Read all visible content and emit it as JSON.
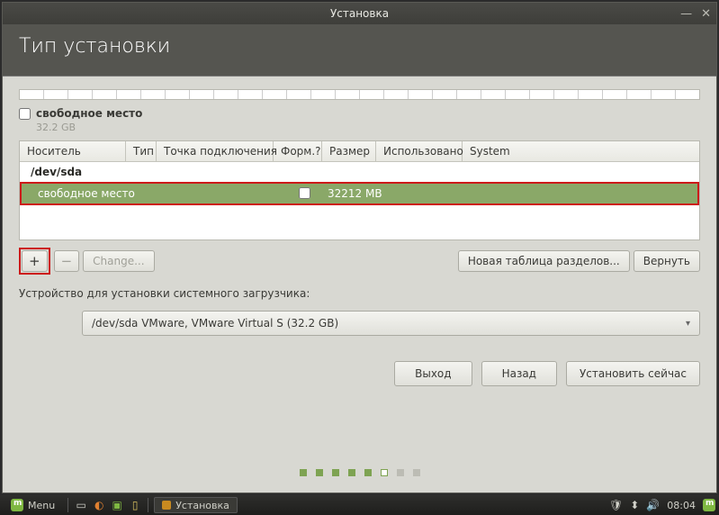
{
  "window": {
    "title": "Установка",
    "header": "Тип установки"
  },
  "free_space": {
    "label": "свободное место",
    "size": "32.2 GB"
  },
  "table": {
    "headers": {
      "device": "Носитель",
      "type": "Тип",
      "mount": "Точка подключения",
      "format": "Форм.?",
      "size": "Размер",
      "used": "Использовано",
      "system": "System"
    },
    "device_row": "/dev/sda",
    "free_row": {
      "label": "свободное место",
      "size": "32212 MB"
    }
  },
  "buttons": {
    "add": "+",
    "remove": "−",
    "change": "Change...",
    "new_table": "Новая таблица разделов...",
    "revert": "Вернуть",
    "quit": "Выход",
    "back": "Назад",
    "install": "Установить сейчас"
  },
  "bootloader": {
    "label": "Устройство для установки системного загрузчика:",
    "value": "/dev/sda VMware, VMware Virtual S (32.2 GB)"
  },
  "taskbar": {
    "menu": "Menu",
    "task": "Установка",
    "time": "08:04"
  }
}
